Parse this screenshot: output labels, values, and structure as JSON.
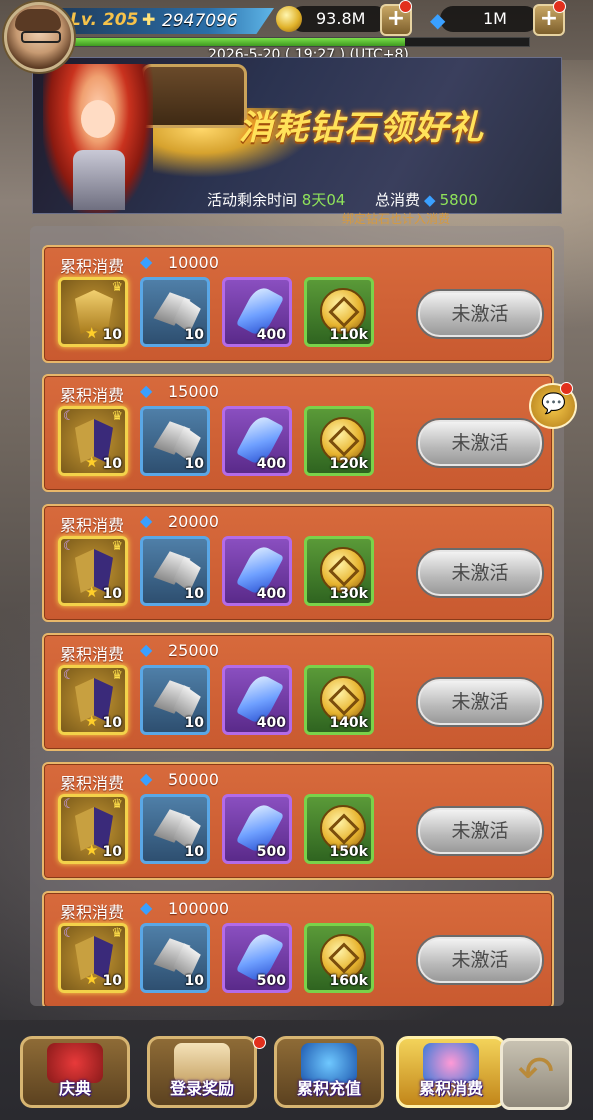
{
  "header": {
    "level": "Lv. 205",
    "power": "2947096",
    "gold": "93.8M",
    "diamonds": "1M",
    "datetime": "2026-5-20 ( 19:27 ) (UTC+8)"
  },
  "banner": {
    "title": "消耗钻石领好礼",
    "remaining_label": "活动剩余时间",
    "remaining_value": "8天04",
    "spent_label": "总消费",
    "spent_value": "5800",
    "note": "绑定钻石也计入消费"
  },
  "tiers": [
    {
      "label": "累积消费",
      "threshold": "10000",
      "items": [
        {
          "name": "emblem",
          "count": "10"
        },
        {
          "name": "shard",
          "count": "10"
        },
        {
          "name": "crystal",
          "count": "400"
        },
        {
          "name": "coin",
          "count": "110k"
        }
      ],
      "button": "未激活"
    },
    {
      "label": "累积消费",
      "threshold": "15000",
      "items": [
        {
          "name": "emblem",
          "count": "10"
        },
        {
          "name": "shard",
          "count": "10"
        },
        {
          "name": "crystal",
          "count": "400"
        },
        {
          "name": "coin",
          "count": "120k"
        }
      ],
      "button": "未激活"
    },
    {
      "label": "累积消费",
      "threshold": "20000",
      "items": [
        {
          "name": "emblem",
          "count": "10"
        },
        {
          "name": "shard",
          "count": "10"
        },
        {
          "name": "crystal",
          "count": "400"
        },
        {
          "name": "coin",
          "count": "130k"
        }
      ],
      "button": "未激活"
    },
    {
      "label": "累积消费",
      "threshold": "25000",
      "items": [
        {
          "name": "emblem",
          "count": "10"
        },
        {
          "name": "shard",
          "count": "10"
        },
        {
          "name": "crystal",
          "count": "400"
        },
        {
          "name": "coin",
          "count": "140k"
        }
      ],
      "button": "未激活"
    },
    {
      "label": "累积消费",
      "threshold": "50000",
      "items": [
        {
          "name": "emblem",
          "count": "10"
        },
        {
          "name": "shard",
          "count": "10"
        },
        {
          "name": "crystal",
          "count": "500"
        },
        {
          "name": "coin",
          "count": "150k"
        }
      ],
      "button": "未激活"
    },
    {
      "label": "累积消费",
      "threshold": "100000",
      "items": [
        {
          "name": "emblem",
          "count": "10"
        },
        {
          "name": "shard",
          "count": "10"
        },
        {
          "name": "crystal",
          "count": "500"
        },
        {
          "name": "coin",
          "count": "160k"
        }
      ],
      "button": "未激活"
    }
  ],
  "nav": [
    {
      "label": "庆典"
    },
    {
      "label": "登录奖励"
    },
    {
      "label": "累积充值"
    },
    {
      "label": "累积消费"
    }
  ],
  "colors": {
    "accent": "#ffe25a",
    "card": "#d76a3c",
    "diamond": "#3aa0ff",
    "value_green": "#8fe35a"
  }
}
